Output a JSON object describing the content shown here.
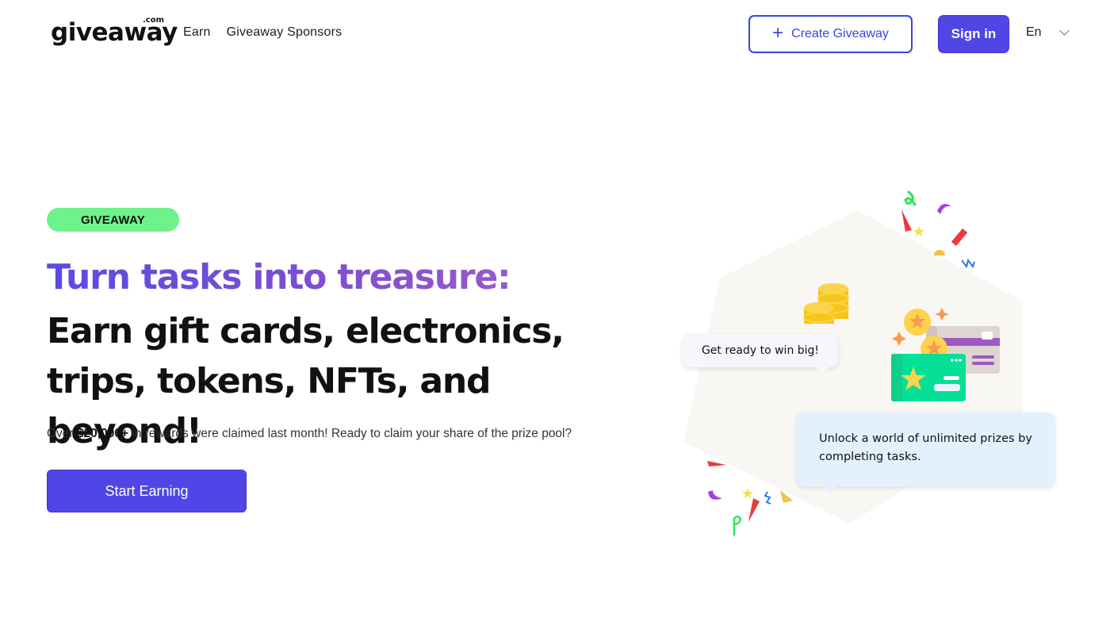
{
  "header": {
    "logo": {
      "word": "giveaway",
      "suffix": ".com"
    },
    "nav": [
      {
        "label": "Earn"
      },
      {
        "label": "Giveaway Sponsors"
      }
    ],
    "create_button": {
      "icon": "plus-icon",
      "label": "Create Giveaway"
    },
    "signin_button": {
      "label": "Sign in"
    },
    "language": {
      "value": "En",
      "icon": "chevron-down-icon"
    }
  },
  "hero": {
    "badge": "GIVEAWAY",
    "title_line1": "Turn tasks into treasure:",
    "title_line2": "Earn gift cards, electronics, trips, tokens, NFTs, and beyond!",
    "subtitle": {
      "prefix": "Over ",
      "highlight": "$20,000+",
      "suffix": " in rewards were claimed last month! Ready to claim your share of the prize pool?"
    },
    "cta": "Start Earning"
  },
  "illustration": {
    "bubble_top": "Get ready to win big!",
    "bubble_bottom": "Unlock a world of unlimited prizes by completing tasks."
  },
  "colors": {
    "primary": "#4f46e5",
    "badge_green": "#6ef28a",
    "gradient_start": "#5b4be0",
    "gradient_end": "#9a58c8",
    "card_green": "#06e097",
    "card_purple": "#9b59c2",
    "coin_gold": "#fdd34d"
  }
}
